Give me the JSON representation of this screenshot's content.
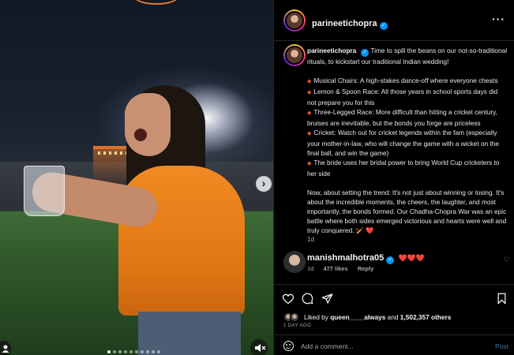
{
  "media": {
    "slide_count": 10,
    "active_slide": 1
  },
  "header": {
    "username": "parineetichopra",
    "more_icon": "more-horizontal-icon",
    "more_label": "···"
  },
  "caption": {
    "username": "parineetichopra",
    "intro": "Time to spill the beans on our not-so-traditional rituals, to kickstart our traditional Indian wedding!",
    "items": [
      "Musical Chairs: A high-stakes dance-off where everyone cheats",
      "Lemon & Spoon Race: All those years in school sports days did not prepare you for this",
      "Three-Legged Race: More difficult than hitting a cricket century, bruises are inevitable, but the bonds you forge are priceless",
      "Cricket: Watch out for cricket legends within the fam (especially your mother-in-law, who will change the game with a wicket on the final ball, and win the game)",
      "The bride uses her bridal power to bring World Cup cricketers to her side"
    ],
    "outro": "Now, about setting the trend: It's not just about winning or losing. It's about the incredible moments, the cheers, the laughter, and most importantly, the bonds formed. Our Chadha-Chopra War was an epic battle where both sides emerged victorious and hearts were well and truly conquered. 🏏 ❤️",
    "time": "1d"
  },
  "comment": {
    "username": "manishmalhotra05",
    "text": "❤️❤️❤️",
    "time": "1d",
    "likes": "477 likes",
    "reply": "Reply"
  },
  "likes": {
    "prefix": "Liked by",
    "user": "queen____always",
    "joiner": "and",
    "others": "1,502,357 others"
  },
  "date": "1 DAY AGO",
  "add_comment": {
    "placeholder": "Add a comment...",
    "post_label": "Post"
  },
  "colors": {
    "accent": "#0095f6",
    "heart": "#ff3040",
    "post_disabled": "#4a73a8",
    "bullet": "#e5572b"
  }
}
